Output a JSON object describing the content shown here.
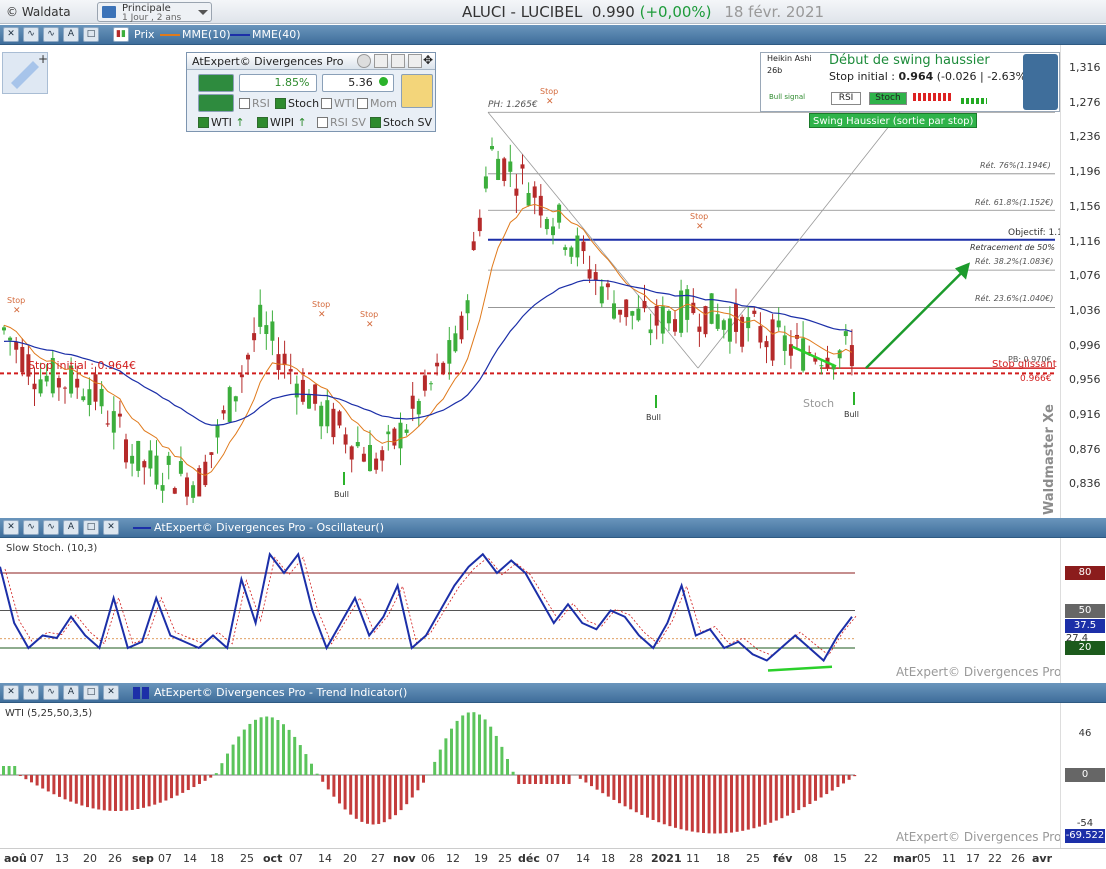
{
  "app": {
    "name": "© Waldata",
    "layout_title": "Principale",
    "layout_sub": "1 Jour , 2 ans"
  },
  "title": {
    "symbol": "ALUCI - LUCIBEL",
    "price": "0.990",
    "change": "(+0,00%)",
    "date": "18 févr. 2021"
  },
  "toolbar": {
    "prix": "Prix",
    "mme10": "MME(10)",
    "mme40": "MME(40)"
  },
  "panel": {
    "title": "AtExpert© Divergences Pro",
    "pct": "1.85%",
    "value": "5.36",
    "rsi": "RSI",
    "stoch": "Stoch",
    "wti": "WTI",
    "mom": "Mom",
    "wti2": "WTI",
    "wipi": "WIPI",
    "rsisv": "RSI SV",
    "stochsv": "Stoch SV"
  },
  "signal": {
    "heikin": "Heikin Ashi",
    "days": "26b",
    "bull": "Bull signal",
    "title": "Début de swing haussier",
    "stop_label": "Stop initial :",
    "stop_val": "0.964",
    "stop_change": "(-0.026 | -2.63%)",
    "rsi": "RSI",
    "stoch": "Stoch",
    "banner": "Swing Haussier (sortie par stop)"
  },
  "price_axis": [
    "1,316",
    "1,276",
    "1,236",
    "1,196",
    "1,156",
    "1,116",
    "1,076",
    "1,036",
    "0,996",
    "0,956",
    "0,916",
    "0,876",
    "0,836"
  ],
  "annotations": {
    "ph": "PH: 1.265€",
    "stop": "Stop",
    "bull": "Bull",
    "ret76": "Rét. 76%(1.194€)",
    "ret618": "Rét. 61.8%(1.152€)",
    "objectif": "Objectif: 1.118€",
    "retr50": "Retracement de 50%",
    "ret382": "Rét. 38.2%(1.083€)",
    "ret236": "Rét. 23.6%(1.040€)",
    "stop_initial": "Stop initial : 0.964€",
    "pb": "PB: 0.970€",
    "stop_glissant": "Stop glissant",
    "stop_glissant_val": "0.966€",
    "stoch_lbl": "Stoch",
    "watermark": "Waldmaster Xe"
  },
  "osc": {
    "toolbar_title": "AtExpert© Divergences Pro - Oscillateur()",
    "label": "Slow Stoch. (10,3)",
    "levels": [
      "80",
      "50",
      "37.5",
      "27.4",
      "20"
    ],
    "footer": "AtExpert© Divergences Pro"
  },
  "trend": {
    "toolbar_title": "AtExpert© Divergences Pro - Trend Indicator()",
    "label": "WTI (5,25,50,3,5)",
    "levels": [
      "46",
      "0",
      "-54",
      "-69.522"
    ],
    "footer": "AtExpert© Divergences Pro"
  },
  "xaxis": [
    "aoû",
    "07",
    "13",
    "20",
    "26",
    "sep",
    "07",
    "14",
    "18",
    "25",
    "oct",
    "07",
    "14",
    "20",
    "27",
    "nov",
    "06",
    "12",
    "19",
    "25",
    "déc",
    "07",
    "14",
    "18",
    "28",
    "2021",
    "11",
    "18",
    "25",
    "fév",
    "08",
    "15",
    "22",
    "mar",
    "05",
    "11",
    "17",
    "22",
    "26",
    "avr"
  ],
  "colors": {
    "up": "#3cae3c",
    "down": "#b52a2a",
    "mme10": "#e07a1c",
    "mme40": "#1c2fa8",
    "stop": "#d11d1d",
    "accent": "#1c9b2c"
  }
}
